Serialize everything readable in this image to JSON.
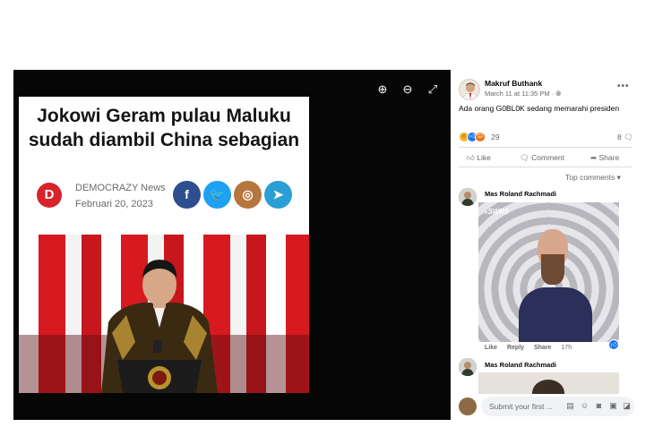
{
  "viewer": {
    "zoom_in_icon": "zoom-in",
    "zoom_out_icon": "zoom-out",
    "fullscreen_icon": "expand"
  },
  "article_image": {
    "headline": "Jokowi Geram pulau Maluku sudah diambil China sebagian",
    "logo_letter": "D",
    "source": "DEMOCRAZY News",
    "date": "Februari 20, 2023",
    "share_icons": [
      "facebook",
      "twitter",
      "instagram",
      "telegram"
    ],
    "colors": {
      "logo": "#d8232a",
      "facebook": "#2d4f8f",
      "twitter": "#1da1f2",
      "instagram": "#b5753c",
      "telegram": "#2a9fd6"
    }
  },
  "post": {
    "author": "Makruf Buthank",
    "timestamp": "March 11 at 11:35 PM",
    "caption": "Ada orang G0BL0K sedang memarahi presiden",
    "reaction_count": "29",
    "comment_count": "8",
    "actions": {
      "like": "Like",
      "comment": "Comment",
      "share": "Share"
    },
    "sort_label": "Top comments"
  },
  "comments": [
    {
      "author": "Mas Roland Rachmadi",
      "gif_watermark": "»SWR3",
      "like_label": "Like",
      "reply_label": "Reply",
      "share_label": "Share",
      "age": "17h"
    },
    {
      "author": "Mas Roland Rachmadi"
    }
  ],
  "composer": {
    "placeholder": "Submit your first ..."
  }
}
